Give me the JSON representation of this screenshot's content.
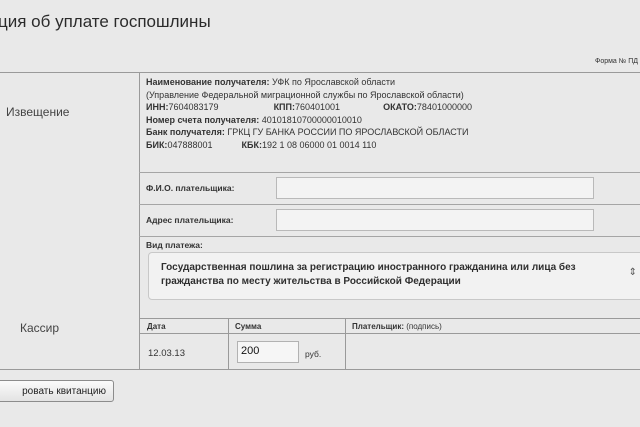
{
  "page_title": "ция об уплате госпошлины",
  "form_code": "Форма № ПД",
  "left": {
    "notice": "Извещение",
    "cashier": "Кассир"
  },
  "recipient": {
    "name_label": "Наименование получателя:",
    "name_value": "УФК по Ярославской области",
    "name_sub": "(Управление Федеральной миграционной службы по Ярославской области)",
    "inn_label": "ИНН:",
    "inn_value": "7604083179",
    "kpp_label": "КПП:",
    "kpp_value": "760401001",
    "okato_label": "ОКАТО:",
    "okato_value": "78401000000",
    "account_label": "Номер счета получателя:",
    "account_value": "40101810700000010010",
    "bank_label": "Банк получателя:",
    "bank_value": "ГРКЦ ГУ БАНКА РОССИИ ПО ЯРОСЛАВСКОЙ ОБЛАСТИ",
    "bik_label": "БИК:",
    "bik_value": "047888001",
    "kbk_label": "КБК:",
    "kbk_value": "192 1 08 06000 01 0014 110"
  },
  "payer": {
    "fio_label": "Ф.И.О. плательщика:",
    "fio_value": "",
    "address_label": "Адрес плательщика:",
    "address_value": ""
  },
  "payment": {
    "type_label": "Вид платежа:",
    "type_value": "Государственная пошлина за регистрацию иностранного гражданина или лица без гражданства по месту жительства в Российской Федерации",
    "arrow": "⇕"
  },
  "footer": {
    "date_label": "Дата",
    "sum_label": "Сумма",
    "payer_sig_label": "Плательщик:",
    "payer_sig_hint": "(подпись)",
    "date_value": "12.03.13",
    "sum_value": "200",
    "currency": "руб."
  },
  "actions": {
    "print_label": "ровать квитанцию"
  }
}
